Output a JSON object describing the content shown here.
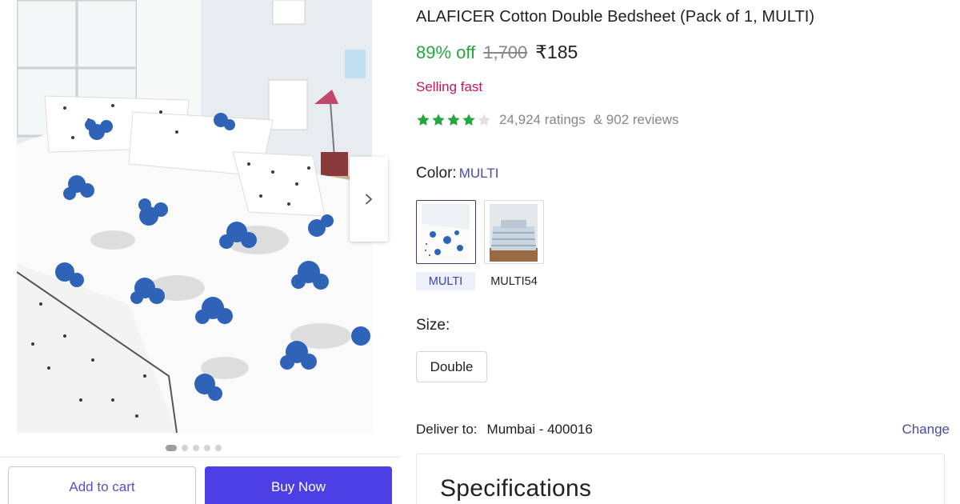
{
  "product": {
    "title": "ALAFICER Cotton Double Bedsheet (Pack of 1, MULTI)",
    "discount": "89% off",
    "mrp": "1,700",
    "price": "₹185",
    "badge": "Selling fast",
    "rating": {
      "stars_filled": 4,
      "stars_total": 5,
      "star_color": "#26a541",
      "ratings_text": "24,924 ratings",
      "reviews_text": "& 902 reviews"
    }
  },
  "gallery": {
    "image_count": 5,
    "active_index": 0,
    "next_icon": "chevron-right-icon"
  },
  "color": {
    "label": "Color:",
    "selected_value": "MULTI",
    "options": [
      {
        "label": "MULTI",
        "selected": true
      },
      {
        "label": "MULTI54",
        "selected": false
      }
    ]
  },
  "size": {
    "label": "Size:",
    "options": [
      {
        "label": "Double",
        "selected": true
      }
    ]
  },
  "delivery": {
    "label": "Deliver to:",
    "location": "Mumbai - 400016",
    "change_label": "Change"
  },
  "specifications": {
    "title": "Specifications"
  },
  "actions": {
    "add_to_cart": "Add to cart",
    "buy_now": "Buy Now",
    "buy_now_color": "#4b3fe6"
  }
}
